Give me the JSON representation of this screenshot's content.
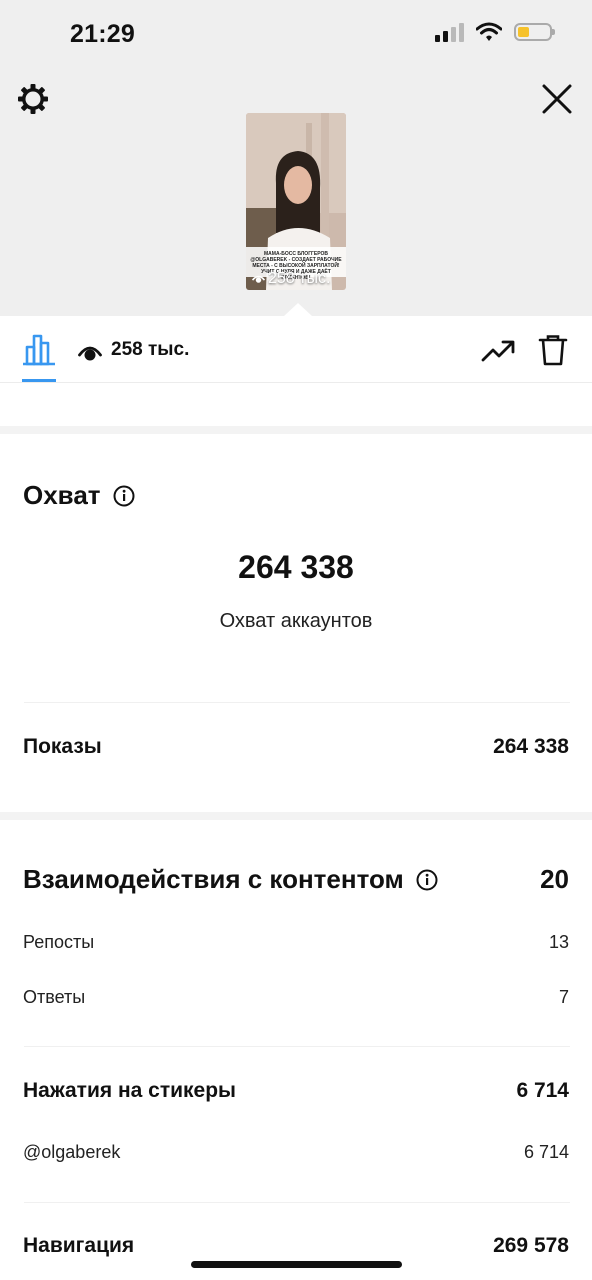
{
  "status_bar": {
    "time": "21:29"
  },
  "preview": {
    "views_overlay": "258 тыс.",
    "caption": "МАМА-БОСС БЛОГГЕРОВ @OLGABEREK - СОЗДАЕТ РАБОЧИЕ МЕСТА - С ВЫСОКОЙ ЗАРПЛАТОЙ! УЧИТ С НУЛЯ И ДАЖЕ ДАЁТ КЛИЕНТОВ!"
  },
  "tabbar": {
    "views": "258 тыс."
  },
  "reach": {
    "title": "Охват",
    "value": "264 338",
    "label": "Охват аккаунтов"
  },
  "impressions": {
    "label": "Показы",
    "value": "264 338"
  },
  "interactions": {
    "title": "Взаимодействия с контентом",
    "value": "20",
    "items": [
      {
        "label": "Репосты",
        "value": "13"
      },
      {
        "label": "Ответы",
        "value": "7"
      }
    ]
  },
  "sticker_taps": {
    "label": "Нажатия на стикеры",
    "value": "6 714",
    "items": [
      {
        "label": "@olgaberek",
        "value": "6 714"
      }
    ]
  },
  "navigation": {
    "label": "Навигация",
    "value": "269 578"
  },
  "colors": {
    "accent": "#3897f0",
    "battery": "#f6c22b",
    "header_bg": "#efefef"
  }
}
